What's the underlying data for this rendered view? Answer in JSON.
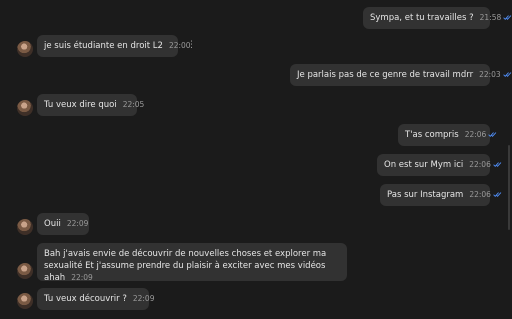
{
  "colors": {
    "background": "#1b1b1b",
    "bubble": "#323232",
    "text": "#e6e6e6",
    "timestamp": "#9a9a9a",
    "read_ticks": "#4f8df5"
  },
  "icons": {
    "read_receipt": "double-check-icon",
    "avatar": "avatar",
    "message_menu": "more-vertical-icon"
  },
  "messages": [
    {
      "side": "out",
      "text": "Sympa, et tu travailles ?",
      "time": "21:58",
      "read": true
    },
    {
      "side": "in",
      "text": "je suis étudiante en droit L2",
      "time": "22:00"
    },
    {
      "side": "out",
      "text": "Je parlais pas de ce genre de travail mdrr",
      "time": "22:03",
      "read": true
    },
    {
      "side": "in",
      "text": "Tu veux dire quoi",
      "time": "22:05"
    },
    {
      "side": "out",
      "text": "T'as compris",
      "time": "22:06",
      "read": true
    },
    {
      "side": "out",
      "text": "On est sur Mym ici",
      "time": "22:06",
      "read": true
    },
    {
      "side": "out",
      "text": "Pas sur Instagram",
      "time": "22:06",
      "read": true
    },
    {
      "side": "in",
      "text": "Ouii",
      "time": "22:09"
    },
    {
      "side": "in",
      "text": "Bah j'avais envie de découvrir de nouvelles choses et explorer ma sexualité Et j'assume prendre du plaisir à exciter avec mes vidéos ahah",
      "time": "22:09"
    },
    {
      "side": "in",
      "text": "Tu veux découvrir ?",
      "time": "22:09"
    }
  ]
}
